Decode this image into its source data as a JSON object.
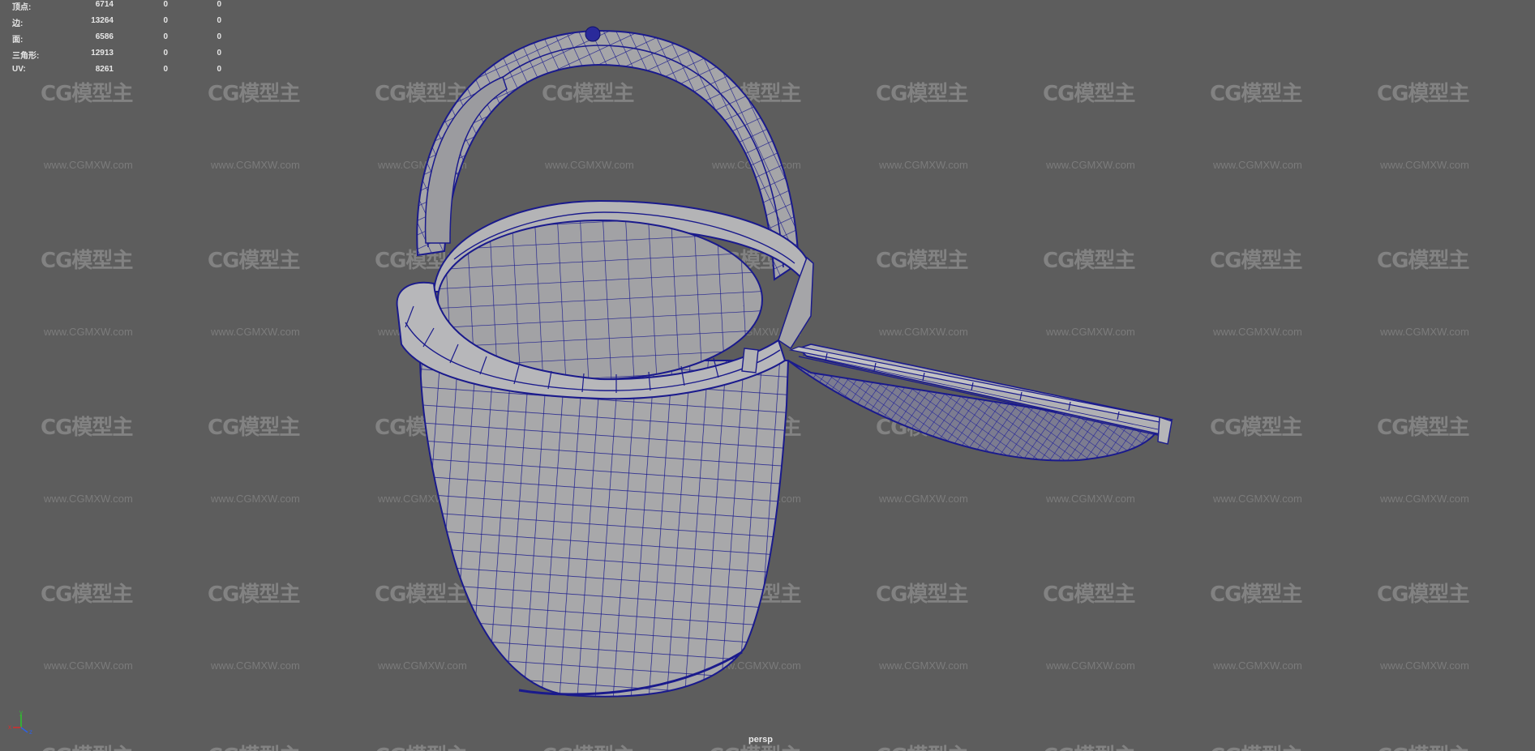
{
  "viewport": {
    "camera": "persp",
    "background_color": "#5d5d5d",
    "wireframe_color": "#1a1a8c",
    "surface_color": "#a7a7a9"
  },
  "stats": {
    "rows": [
      {
        "label": "顶点:",
        "total": "6714",
        "selected": "0",
        "uv_selected": "0"
      },
      {
        "label": "边:",
        "total": "13264",
        "selected": "0",
        "uv_selected": "0"
      },
      {
        "label": "面:",
        "total": "6586",
        "selected": "0",
        "uv_selected": "0"
      },
      {
        "label": "三角形:",
        "total": "12913",
        "selected": "0",
        "uv_selected": "0"
      },
      {
        "label": "UV:",
        "total": "8261",
        "selected": "0",
        "uv_selected": "0"
      }
    ]
  },
  "watermark": {
    "logo": "CG模型主",
    "url": "www.CGMXW.com"
  },
  "axis_gizmo": {
    "x": "x",
    "y": "y",
    "z": "z",
    "x_color": "#d03030",
    "y_color": "#30c030",
    "z_color": "#3060e0"
  }
}
